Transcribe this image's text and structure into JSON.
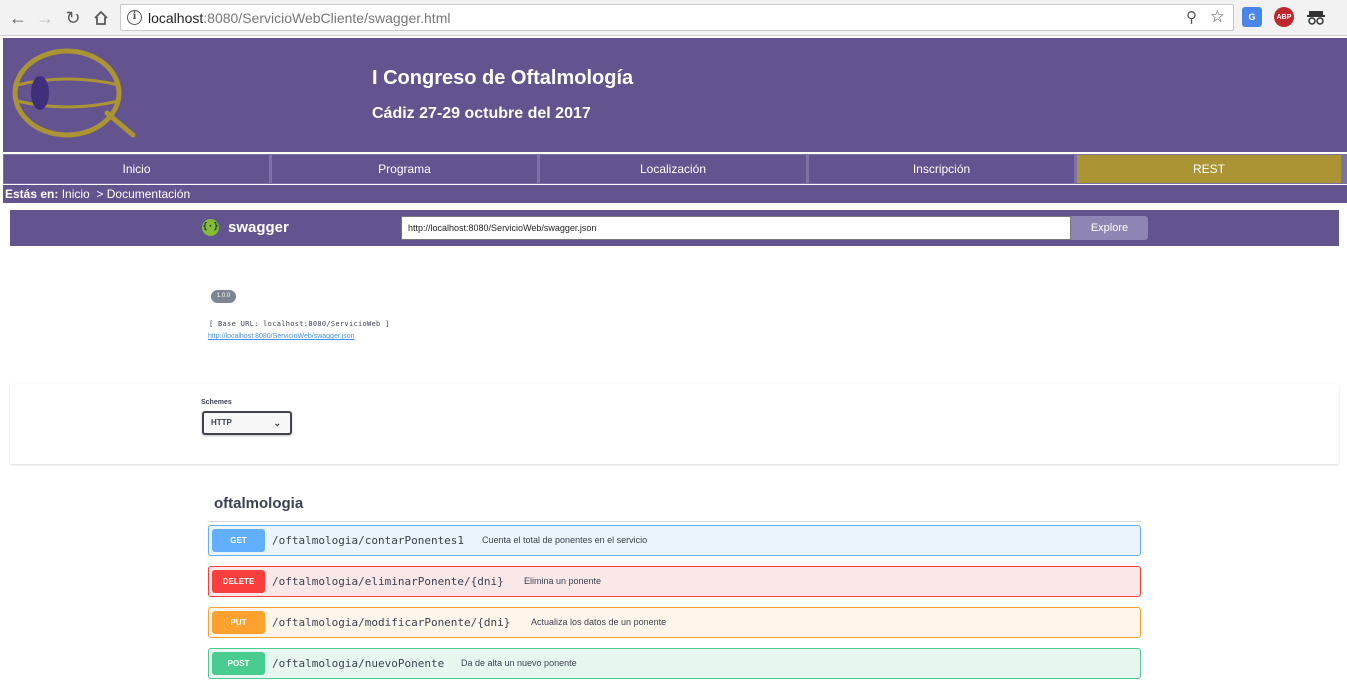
{
  "browser": {
    "url_host": "localhost",
    "url_rest": ":8080/ServicioWebCliente/swagger.html",
    "ext_translate": "G",
    "ext_abp": "ABP"
  },
  "site": {
    "title": "I Congreso de Oftalmología",
    "subtitle": "Cádiz 27-29 octubre del 2017"
  },
  "menu": [
    {
      "label": "Inicio"
    },
    {
      "label": "Programa"
    },
    {
      "label": "Localización"
    },
    {
      "label": "Inscripción"
    },
    {
      "label": "REST",
      "active": true
    }
  ],
  "breadcrumb": {
    "prefix": "Estás en:",
    "home": "Inicio",
    "separator": ">",
    "current": "Documentación"
  },
  "swagger": {
    "brand": "swagger",
    "spec_url": "http://localhost:8080/ServicioWeb/swagger.json",
    "explore_label": "Explore",
    "version": "1.0.0",
    "base_url": "[ Base URL: localhost:8080/ServicioWeb ]",
    "spec_link": "http://localhost:8080/ServicioWeb/swagger.json",
    "schemes_label": "Schemes",
    "schemes_selected": "HTTP",
    "tag": "oftalmologia",
    "operations": [
      {
        "method": "GET",
        "path": "/oftalmologia/contarPonentes1",
        "summary": "Cuenta el total de ponentes en el servicio"
      },
      {
        "method": "DELETE",
        "path": "/oftalmologia/eliminarPonente/{dni}",
        "summary": "Elimina un ponente"
      },
      {
        "method": "PUT",
        "path": "/oftalmologia/modificarPonente/{dni}",
        "summary": "Actualiza los datos de un ponente"
      },
      {
        "method": "POST",
        "path": "/oftalmologia/nuevoPonente",
        "summary": "Da de alta un nuevo ponente"
      }
    ]
  },
  "colors": {
    "brand_purple": "#63538f",
    "active_gold": "#aa9433",
    "get": "#61affe",
    "delete": "#f93e3e",
    "put": "#fca130",
    "post": "#49cc90"
  }
}
